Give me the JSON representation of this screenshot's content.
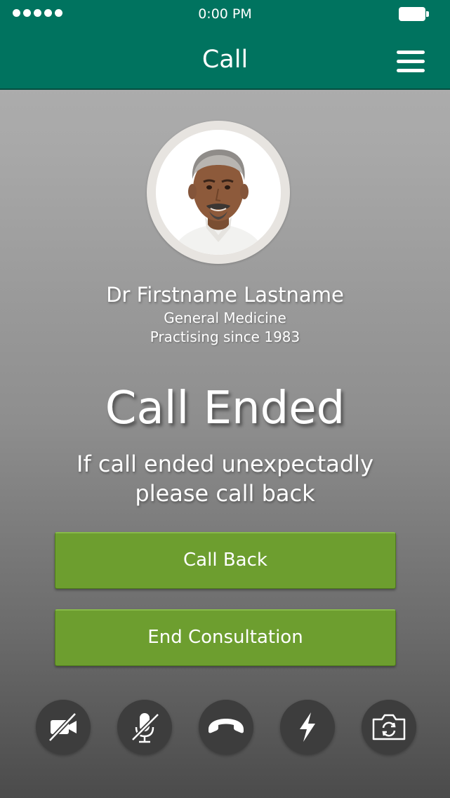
{
  "status_bar": {
    "time": "0:00 PM",
    "signal_icon": "signal-dots-icon",
    "battery_icon": "battery-icon"
  },
  "header": {
    "title": "Call",
    "menu_icon": "hamburger-menu-icon",
    "background_color": "#00735f"
  },
  "doctor": {
    "name": "Dr Firstname Lastname",
    "specialty": "General Medicine",
    "practising": "Practising since 1983"
  },
  "call": {
    "status": "Call Ended",
    "message": "If call ended unexpectadly please call back"
  },
  "buttons": {
    "call_back": "Call Back",
    "end_consultation": "End Consultation",
    "color": "#6d9e2f"
  },
  "controls": [
    {
      "icon": "video-off-icon"
    },
    {
      "icon": "mic-off-icon"
    },
    {
      "icon": "hang-up-phone-icon"
    },
    {
      "icon": "flash-icon"
    },
    {
      "icon": "switch-camera-icon"
    }
  ]
}
